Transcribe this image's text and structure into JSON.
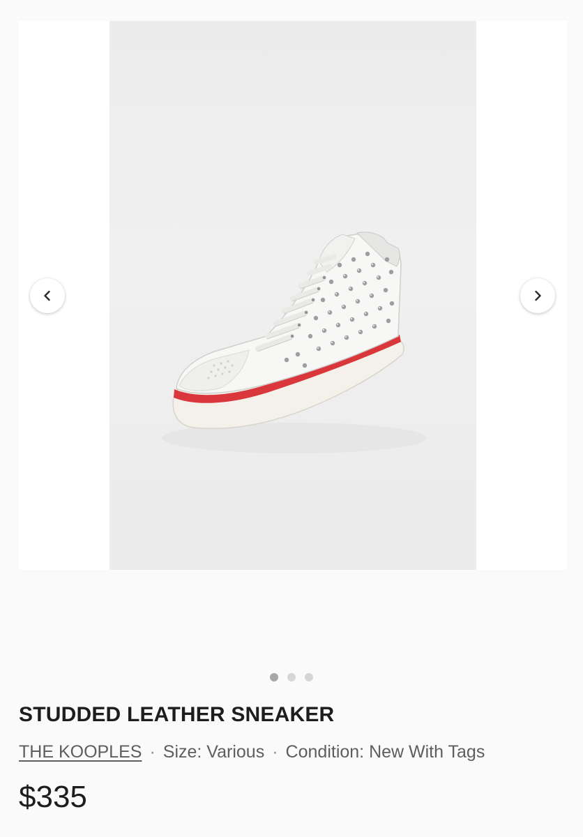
{
  "gallery": {
    "image_alt": "White studded leather high-top sneaker with red sole stripe",
    "slide_count": 3,
    "active_slide": 1
  },
  "product": {
    "title": "STUDDED LEATHER SNEAKER",
    "brand": "THE KOOPLES",
    "separator": "·",
    "size": "Size: Various",
    "condition": "Condition: New With Tags",
    "price": "$335"
  },
  "icons": {
    "prev": "chevron-left-icon",
    "next": "chevron-right-icon"
  },
  "colors": {
    "sole_stripe": "#d9373b",
    "text_primary": "#1d1d1d",
    "text_secondary": "#5e5e5e"
  }
}
